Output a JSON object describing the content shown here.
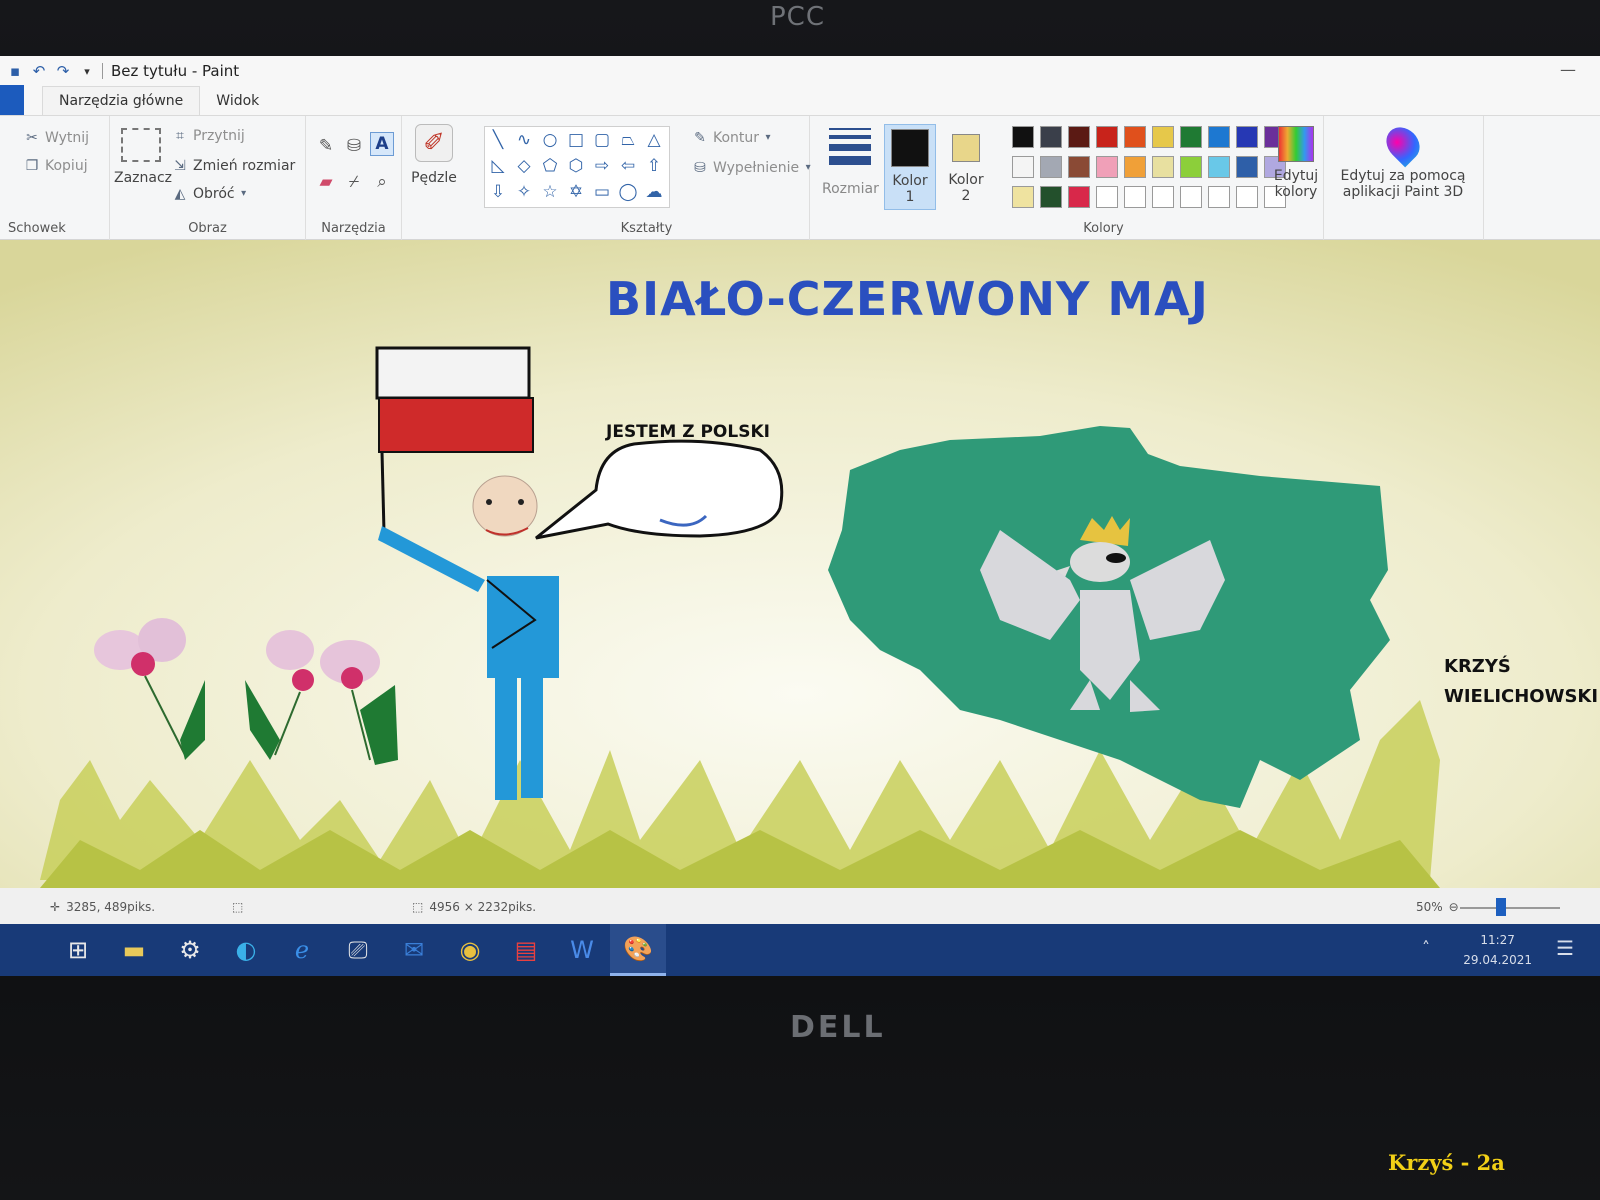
{
  "bezel": {
    "top_logo": "PCC",
    "bottom_logo": "DELL",
    "caption": "Krzyś - 2a"
  },
  "window": {
    "title": "Bez tytułu - Paint"
  },
  "tabs": [
    {
      "label": "Narzędzia główne"
    },
    {
      "label": "Widok"
    }
  ],
  "ribbon": {
    "clipboard": {
      "cut": "Wytnij",
      "copy": "Kopiuj",
      "label": "Schowek"
    },
    "image": {
      "select": "Zaznacz",
      "crop": "Przytnij",
      "resize": "Zmień rozmiar",
      "rotate": "Obróć",
      "label": "Obraz"
    },
    "tools": {
      "label": "Narzędzia"
    },
    "brushes": {
      "label": "Pędzle"
    },
    "shapes": {
      "outline": "Kontur",
      "fill": "Wypełnienie",
      "label": "Kształty"
    },
    "size": {
      "label": "Rozmiar"
    },
    "colors": {
      "color1_label": "Kolor",
      "color1_num": "1",
      "color2_label": "Kolor",
      "color2_num": "2",
      "color1": "#111111",
      "color2": "#e8d68a",
      "edit_label": "Edytuj",
      "edit_label2": "kolory",
      "paint3d_label": "Edytuj za pomocą",
      "paint3d_label2": "aplikacji Paint 3D",
      "label": "Kolory",
      "palette": [
        "#111111",
        "#3a3f4a",
        "#5b1a14",
        "#c8231b",
        "#e0501c",
        "#e6c84a",
        "#1f7a33",
        "#1d78d1",
        "#2638b4",
        "#6a2f9a",
        "#f4f4f4",
        "#a3a8b3",
        "#8a4a35",
        "#f0a0b8",
        "#f0a038",
        "#e8e0a0",
        "#8ccf3a",
        "#69c8e8",
        "#2e5fa8",
        "#b0a8e0",
        "#efe3a0",
        "#23502c",
        "#d8284a",
        "#ffffff",
        "#ffffff",
        "#ffffff",
        "#ffffff",
        "#ffffff",
        "#ffffff",
        "#ffffff"
      ]
    }
  },
  "canvas": {
    "heading": "BIAŁO-CZERWONY MAJ",
    "bubble": "JESTEM Z POLSKI",
    "author_line1": "KRZYŚ",
    "author_line2": "WIELICHOWSKI"
  },
  "status": {
    "cursor": "3285, 489piks.",
    "size": "4956 × 2232piks.",
    "zoom": "50%"
  },
  "taskbar": {
    "time": "11:27",
    "date": "29.04.2021"
  }
}
